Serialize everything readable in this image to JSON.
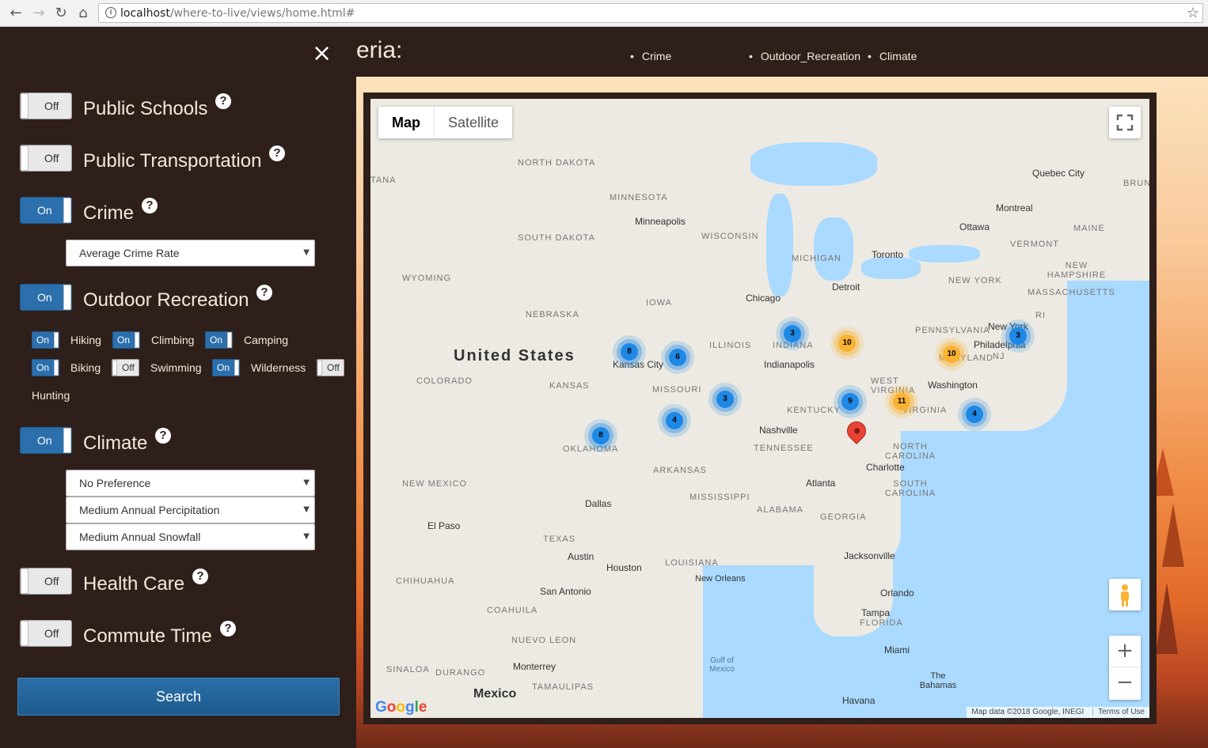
{
  "browser": {
    "url_host": "localhost",
    "url_path": "/where-to-live/views/home.html#"
  },
  "header": {
    "title_fragment": "eria:",
    "criteria": [
      "Crime",
      "Outdoor_Recreation",
      "Climate"
    ]
  },
  "sidebar": {
    "close_glyph": "×",
    "sections": {
      "public_schools": {
        "label": "Public Schools",
        "state": "Off"
      },
      "public_transportation": {
        "label": "Public Transportation",
        "state": "Off"
      },
      "crime": {
        "label": "Crime",
        "state": "On",
        "select_value": "Average Crime Rate"
      },
      "outdoor_recreation": {
        "label": "Outdoor Recreation",
        "state": "On"
      },
      "climate": {
        "label": "Climate",
        "state": "On",
        "selects": [
          "No Preference",
          "Medium Annual Percipitation",
          "Medium Annual Snowfall"
        ]
      },
      "health_care": {
        "label": "Health Care",
        "state": "Off"
      },
      "commute_time": {
        "label": "Commute Time",
        "state": "Off"
      }
    },
    "recreation": {
      "hiking": {
        "label": "Hiking",
        "state": "On"
      },
      "climbing": {
        "label": "Climbing",
        "state": "On"
      },
      "camping": {
        "label": "Camping",
        "state": "On"
      },
      "biking": {
        "label": "Biking",
        "state": "On"
      },
      "swimming": {
        "label": "Swimming",
        "state": "Off"
      },
      "wilderness": {
        "label": "Wilderness",
        "state": "On"
      },
      "hunting": {
        "label": "Hunting",
        "state": "Off"
      }
    },
    "search_label": "Search",
    "help_glyph": "?"
  },
  "map": {
    "type_buttons": [
      "Map",
      "Satellite"
    ],
    "active_type": "Map",
    "country_label": "United States",
    "states": [
      "NORTH DAKOTA",
      "MINNESOTA",
      "SOUTH DAKOTA",
      "WISCONSIN",
      "MICHIGAN",
      "WYOMING",
      "IOWA",
      "NEBRASKA",
      "ILLINOIS",
      "INDIANA",
      "COLORADO",
      "KANSAS",
      "MISSOURI",
      "KENTUCKY",
      "WEST VIRGINIA",
      "VIRGINIA",
      "PENNSYLVANIA",
      "NEW YORK",
      "OKLAHOMA",
      "TENNESSEE",
      "NORTH CAROLINA",
      "ARKANSAS",
      "NEW MEXICO",
      "MISSISSIPPI",
      "ALABAMA",
      "GEORGIA",
      "SOUTH CAROLINA",
      "TEXAS",
      "LOUISIANA",
      "FLORIDA",
      "VERMONT",
      "MAINE",
      "NEW HAMPSHIRE",
      "MASSACHUSETTS",
      "CHIHUAHUA",
      "COAHUILA",
      "NUEVO LEON",
      "SINALOA",
      "DURANGO",
      "TAMAULIPAS",
      "MARYLAND",
      "NJ",
      "RI",
      "BRUN",
      "TANA"
    ],
    "cities": [
      "Quebec City",
      "Montreal",
      "Ottawa",
      "Minneapolis",
      "Toronto",
      "Detroit",
      "Chicago",
      "New York",
      "Philadelphia",
      "Washington",
      "Indianapolis",
      "Kansas City",
      "Nashville",
      "Charlotte",
      "Atlanta",
      "Dallas",
      "El Paso",
      "Austin",
      "Houston",
      "San Antonio",
      "New Orleans",
      "Jacksonville",
      "Orlando",
      "Tampa",
      "Miami",
      "Monterrey",
      "Mexico",
      "Havana",
      "The Bahamas"
    ],
    "water": "Gulf of Mexico",
    "clusters": [
      {
        "count": "8",
        "color": "blue"
      },
      {
        "count": "6",
        "color": "blue"
      },
      {
        "count": "3",
        "color": "blue"
      },
      {
        "count": "10",
        "color": "orange"
      },
      {
        "count": "10",
        "color": "orange"
      },
      {
        "count": "3",
        "color": "blue"
      },
      {
        "count": "3",
        "color": "blue"
      },
      {
        "count": "9",
        "color": "blue"
      },
      {
        "count": "11",
        "color": "orange"
      },
      {
        "count": "4",
        "color": "blue"
      },
      {
        "count": "4",
        "color": "blue"
      },
      {
        "count": "8",
        "color": "blue"
      }
    ],
    "zoom_in": "+",
    "zoom_out": "−",
    "google_logo": "Google",
    "attribution": "Map data ©2018 Google, INEGI",
    "terms": "Terms of Use"
  }
}
